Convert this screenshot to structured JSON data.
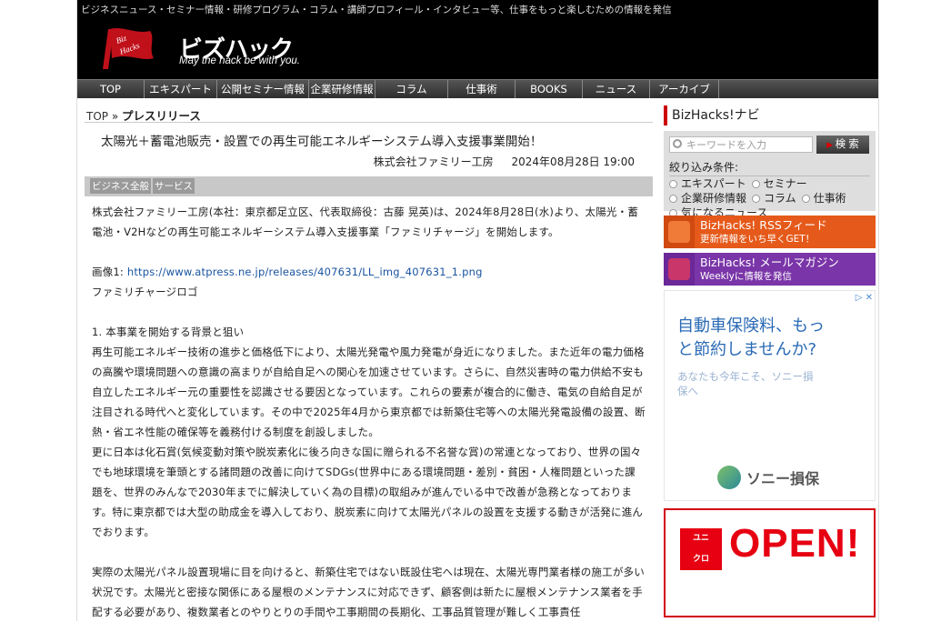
{
  "header": {
    "tagline": "ビジネスニュース・セミナー情報・研修プログラム・コラム・講師プロフィール・インタビュー等、仕事をもっと楽しむための情報を発信",
    "logo_flag_text": "Biz Hacks",
    "logo_wordmark": "ビズハック",
    "logo_slogan": "May the hack be with you."
  },
  "nav": {
    "items": [
      {
        "label": "TOP"
      },
      {
        "label": "エキスパート"
      },
      {
        "label": "公開セミナー情報"
      },
      {
        "label": "企業研修情報"
      },
      {
        "label": "コラム"
      },
      {
        "label": "仕事術"
      },
      {
        "label": "BOOKS"
      },
      {
        "label": "ニュース"
      },
      {
        "label": "アーカイブ"
      }
    ]
  },
  "breadcrumb": {
    "top": "TOP",
    "separator": "»",
    "current": "プレスリリース"
  },
  "article": {
    "title": "太陽光＋蓄電池販売・設置での再生可能エネルギーシステム導入支援事業開始！",
    "company": "株式会社ファミリー工房",
    "datetime": "2024年08月28日 19:00",
    "categories": [
      "ビジネス全般",
      "サービス"
    ],
    "intro": "株式会社ファミリー工房(本社：東京都足立区、代表取締役：古藤 晃英)は、2024年8月28日(水)より、太陽光・蓄電池・V2Hなどの再生可能エネルギーシステム導入支援事業「ファミリチャージ」を開始します。",
    "image_label": "画像1: ",
    "image_url": "https://www.atpress.ne.jp/releases/407631/LL_img_407631_1.png",
    "image_caption": "ファミリチャージロゴ",
    "section1_heading": "1. 本事業を開始する背景と狙い",
    "section1_p1": "再生可能エネルギー技術の進歩と価格低下により、太陽光発電や風力発電が身近になりました。また近年の電力価格の高騰や環境問題への意識の高まりが自給自足への関心を加速させています。さらに、自然災害時の電力供給不安も自立したエネルギー元の重要性を認識させる要因となっています。これらの要素が複合的に働き、電気の自給自足が注目される時代へと変化しています。その中で2025年4月から東京都では新築住宅等への太陽光発電設備の設置、断熱・省エネ性能の確保等を義務付ける制度を創設しました。",
    "section1_p2": "更に日本は化石賞(気候変動対策や脱炭素化に後ろ向きな国に贈られる不名誉な賞)の常連となっており、世界の国々でも地球環境を筆頭とする諸問題の改善に向けてSDGs(世界中にある環境問題・差別・貧困・人権問題といった課題を、世界のみんなで2030年までに解決していく為の目標)の取組みが進んでいる中で改善が急務となっております。特に東京都では大型の助成金を導入しており、脱炭素に向けて太陽光パネルの設置を支援する動きが活発に進んでおります。",
    "section1_p3": "実際の太陽光パネル設置現場に目を向けると、新築住宅ではない既設住宅へは現在、太陽光専門業者様の施工が多い状況です。太陽光と密接な関係にある屋根のメンテナンスに対応できず、顧客側は新たに屋根メンテナンス業者を手配する必要があり、複数業者とのやりとりの手間や工事期間の長期化、工事品質管理が難しく工事責任"
  },
  "sidebar": {
    "navi_title": "BizHacks!ナビ",
    "search_placeholder": "キーワードを入力",
    "search_button": "検 索",
    "filter_label": "絞り込み条件:",
    "filters": [
      "エキスパート",
      "セミナー",
      "企業研修情報",
      "コラム",
      "仕事術",
      "気になるニュース"
    ],
    "rss_title": "BizHacks! RSSフィード",
    "rss_sub": "更新情報をいち早くGET！",
    "mail_title": "BizHacks! メールマガジン",
    "mail_sub": "Weeklyに情報を発信",
    "ad1_headline_1": "自動車保険料、もっ",
    "ad1_headline_2": "と節約しませんか?",
    "ad1_sub_1": "あなたも今年こそ、ソニー損",
    "ad1_sub_2": "保へ",
    "ad1_brand": "ソニー損保",
    "ad1_corner": "▷ ✕",
    "ad2_logo_1": "ユニ",
    "ad2_logo_2": "クロ",
    "ad2_open": "OPEN!"
  },
  "colors": {
    "accent_red": "#d2000f",
    "rss_orange": "#e55a1a",
    "mail_purple": "#7a35a8",
    "link_blue": "#1a55a0"
  }
}
